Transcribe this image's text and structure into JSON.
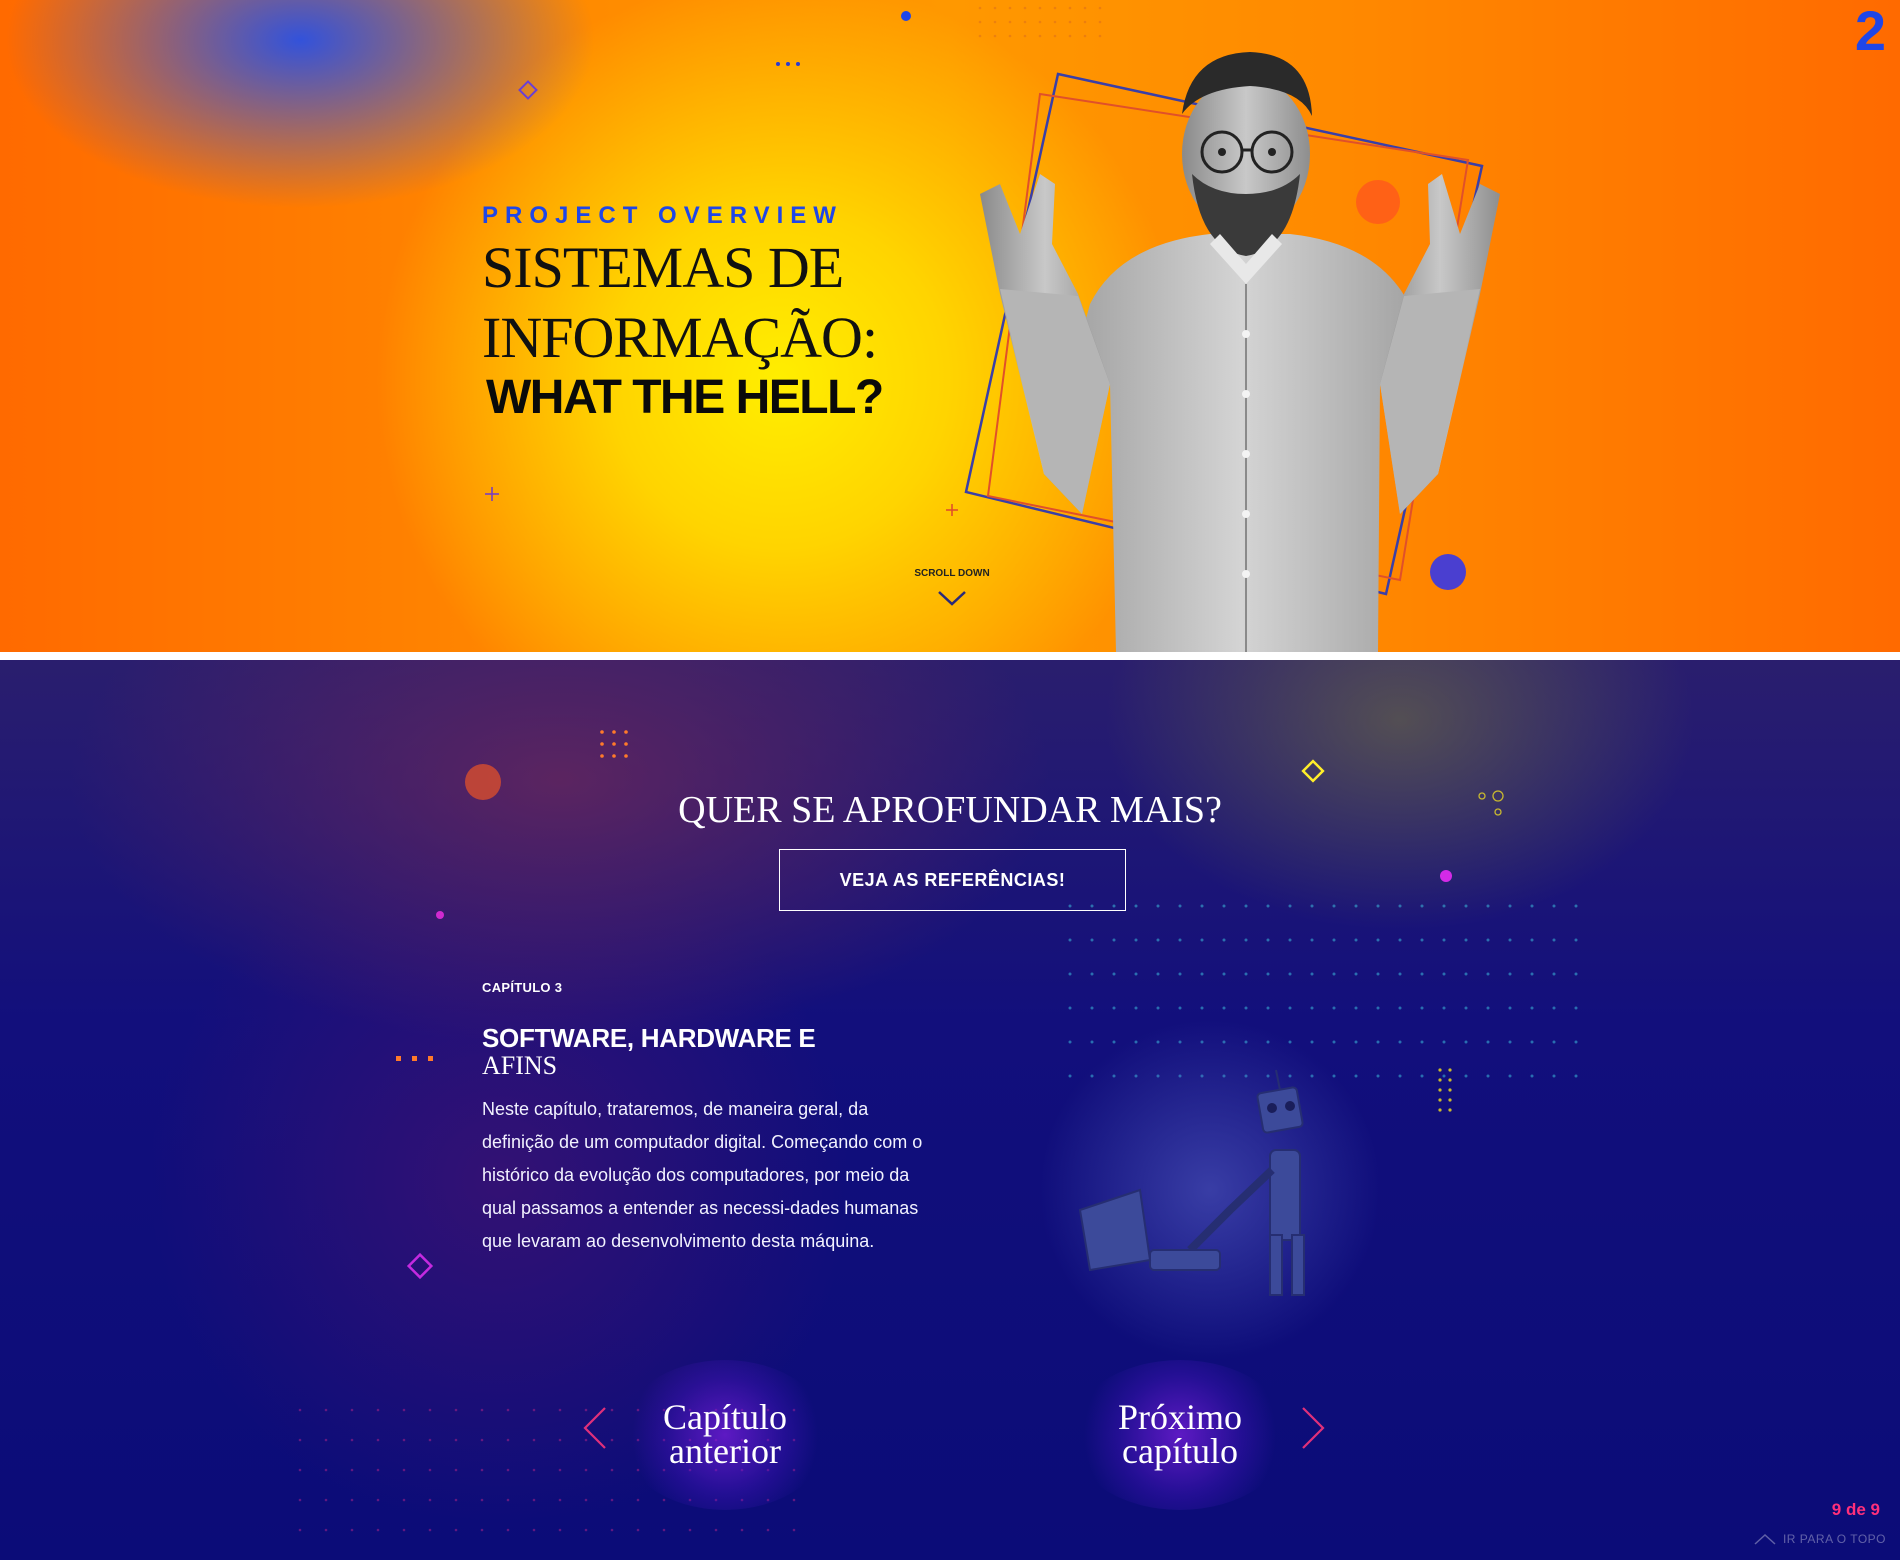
{
  "hero": {
    "page_number": "2",
    "eyebrow": "PROJECT OVERVIEW",
    "title_line1": "SISTEMAS DE",
    "title_line2": "INFORMAÇÃO:",
    "title_bold": "WHAT THE HELL?",
    "scroll_label": "SCROLL DOWN"
  },
  "cta": {
    "title_part1": "QUER ",
    "title_highlight": "SE APROFUNDAR",
    "title_part2": " MAIS?",
    "button_label": "VEJA AS REFERÊNCIAS!"
  },
  "chapter": {
    "label": "CAPÍTULO 3",
    "title_bold": "SOFTWARE, HARDWARE E",
    "title_light": "AFINS",
    "body": "Neste capítulo, trataremos, de maneira geral, da definição de um computador digital. Começando com o histórico da evolução dos computadores, por meio da qual passamos a entender as necessi-dades humanas que levaram ao desenvolvimento desta máquina."
  },
  "nav": {
    "prev_line1": "Capítulo",
    "prev_line2": "anterior",
    "next_line1": "Próximo",
    "next_line2": "capítulo"
  },
  "footer": {
    "pager": "9 de 9",
    "to_top": "IR PARA O TOPO"
  },
  "colors": {
    "accent_blue": "#1f46e8",
    "highlight_yellow": "#ffee2a",
    "pager_pink": "#ff2f7a",
    "hero_orange": "#ff6a00",
    "dark_navy": "#0b0c78"
  },
  "icons": [
    "chevron-down-icon",
    "chevron-left-icon",
    "chevron-right-icon",
    "chevron-up-icon"
  ]
}
